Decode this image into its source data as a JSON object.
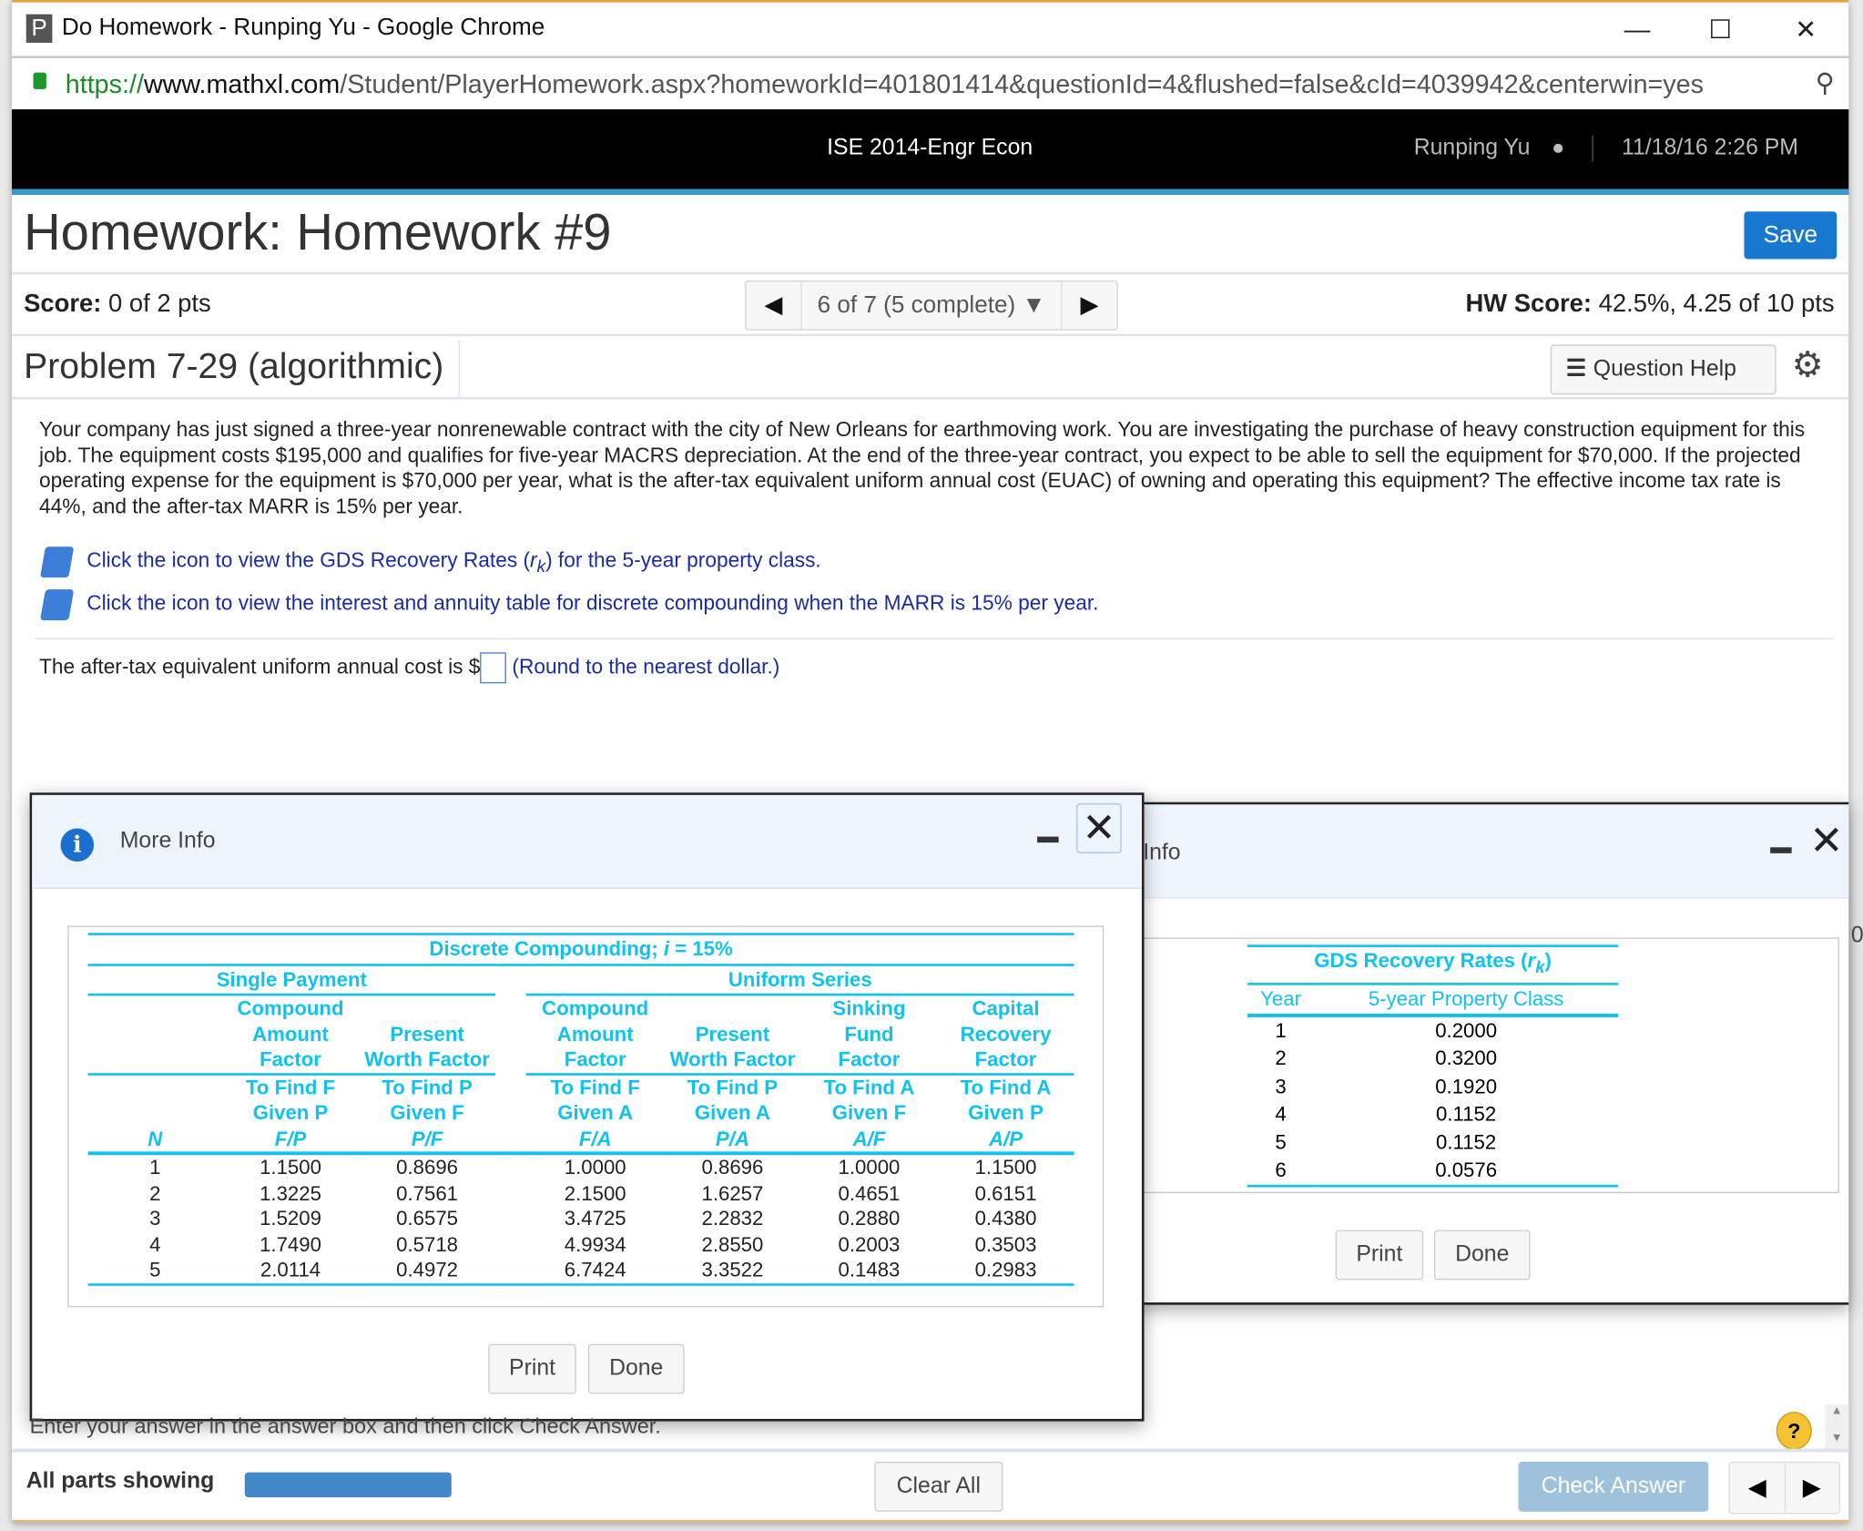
{
  "browser": {
    "window_title": "Do Homework - Runping Yu - Google Chrome",
    "favicon_letter": "P",
    "url_scheme": "https://",
    "url_domain": "www.mathxl.com",
    "url_path": "/Student/PlayerHomework.aspx?homeworkId=401801414&questionId=4&flushed=false&cId=4039942&centerwin=yes"
  },
  "topnav": {
    "course": "ISE 2014-Engr Econ",
    "user": "Runping Yu",
    "datetime": "11/18/16 2:26 PM"
  },
  "header": {
    "title": "Homework: Homework #9",
    "save_label": "Save"
  },
  "score": {
    "label": "Score:",
    "value": "0 of 2 pts",
    "nav_position": "6 of 7 (5 complete)",
    "hw_label": "HW Score:",
    "hw_value": "42.5%, 4.25 of 10 pts"
  },
  "problem": {
    "title": "Problem 7-29 (algorithmic)",
    "help_label": "Question Help"
  },
  "question": {
    "text": "Your company has just signed a three-year nonrenewable contract with the city of New Orleans for earthmoving work. You are investigating the purchase of heavy construction equipment for this job. The equipment costs $195,000 and qualifies for five-year MACRS depreciation. At the end of the three-year contract, you expect to be able to sell the equipment for $70,000. If the projected operating expense for the equipment is $70,000 per year, what is the after-tax equivalent uniform annual cost (EUAC) of owning and operating this equipment? The effective income tax rate is 44%, and the after-tax MARR is 15% per year.",
    "link1_pre": "Click the icon to view the GDS Recovery Rates (",
    "link1_r": "r",
    "link1_k": "k",
    "link1_post": ") for the 5-year property class.",
    "link2": "Click the icon to view the interest and annuity table for discrete compounding when the MARR is 15% per year.",
    "answer_prefix": "The after-tax equivalent uniform annual cost is $",
    "answer_value": "",
    "answer_hint": "(Round to the nearest dollar.)"
  },
  "dialog_interest": {
    "title": "More Info",
    "table_title": "Discrete Compounding; i = 15%",
    "group1": "Single Payment",
    "group2": "Uniform Series",
    "col_names": [
      [
        "Compound",
        "Amount",
        "Factor"
      ],
      [
        "",
        "Present",
        "Worth Factor"
      ],
      [
        "Compound",
        "Amount",
        "Factor"
      ],
      [
        "",
        "Present",
        "Worth Factor"
      ],
      [
        "Sinking",
        "Fund",
        "Factor"
      ],
      [
        "Capital",
        "Recovery",
        "Factor"
      ]
    ],
    "col_finds": [
      [
        "To Find F",
        "Given P",
        "F/P"
      ],
      [
        "To Find P",
        "Given F",
        "P/F"
      ],
      [
        "To Find F",
        "Given A",
        "F/A"
      ],
      [
        "To Find P",
        "Given A",
        "P/A"
      ],
      [
        "To Find A",
        "Given F",
        "A/F"
      ],
      [
        "To Find A",
        "Given P",
        "A/P"
      ]
    ],
    "n_label": "N",
    "rows": [
      [
        "1",
        "1.1500",
        "0.8696",
        "1.0000",
        "0.8696",
        "1.0000",
        "1.1500"
      ],
      [
        "2",
        "1.3225",
        "0.7561",
        "2.1500",
        "1.6257",
        "0.4651",
        "0.6151"
      ],
      [
        "3",
        "1.5209",
        "0.6575",
        "3.4725",
        "2.2832",
        "0.2880",
        "0.4380"
      ],
      [
        "4",
        "1.7490",
        "0.5718",
        "4.9934",
        "2.8550",
        "0.2003",
        "0.3503"
      ],
      [
        "5",
        "2.0114",
        "0.4972",
        "6.7424",
        "3.3522",
        "0.1483",
        "0.2983"
      ]
    ],
    "print_label": "Print",
    "done_label": "Done"
  },
  "dialog_gds": {
    "title_partial": "Info",
    "table_title": "GDS Recovery Rates (rk)",
    "table_title_pre": "GDS Recovery Rates (",
    "table_title_r": "r",
    "table_title_k": "k",
    "table_title_post": ")",
    "col_year": "Year",
    "col_class": "5-year Property Class",
    "rows": [
      [
        "1",
        "0.2000"
      ],
      [
        "2",
        "0.3200"
      ],
      [
        "3",
        "0.1920"
      ],
      [
        "4",
        "0.1152"
      ],
      [
        "5",
        "0.1152"
      ],
      [
        "6",
        "0.0576"
      ]
    ],
    "print_label": "Print",
    "done_label": "Done",
    "edge_char": "0"
  },
  "footer": {
    "instruction": "Enter your answer in the answer box and then click Check Answer.",
    "all_parts": "All parts showing",
    "progress": 1.0,
    "clear_all": "Clear All",
    "check_answer": "Check Answer",
    "help": "?"
  },
  "colors": {
    "accent": "#1878d0",
    "table_cyan": "#10c2ef",
    "topnav": "#000000",
    "topnav_underline": "#3a9ac9",
    "check_answer_disabled": "#9fc2dc"
  }
}
